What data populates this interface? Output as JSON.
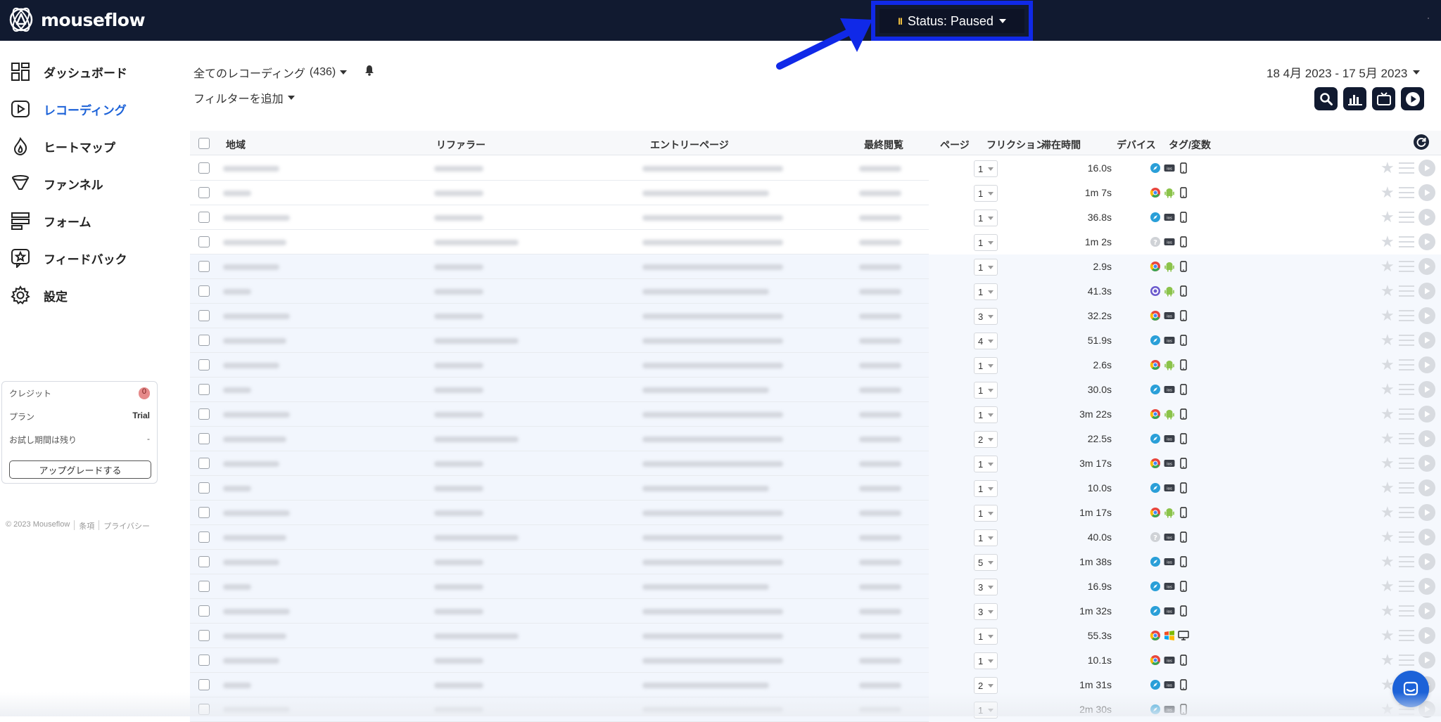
{
  "app": {
    "logo_text": "mouseflow"
  },
  "status": {
    "label": "Status: Paused",
    "pause_glyph": "II"
  },
  "sidebar": {
    "items": [
      {
        "label": "ダッシュボード",
        "icon": "dashboard-icon"
      },
      {
        "label": "レコーディング",
        "icon": "play-square-icon"
      },
      {
        "label": "ヒートマップ",
        "icon": "flame-icon"
      },
      {
        "label": "ファンネル",
        "icon": "funnel-icon"
      },
      {
        "label": "フォーム",
        "icon": "form-icon"
      },
      {
        "label": "フィードバック",
        "icon": "feedback-star-icon"
      },
      {
        "label": "設定",
        "icon": "gear-icon"
      }
    ],
    "credit": {
      "credit_label": "クレジット",
      "credit_value": "0",
      "plan_label": "プラン",
      "plan_value": "Trial",
      "trial_label": "お試し期間は残り",
      "trial_value": "-",
      "upgrade_label": "アップグレードする"
    },
    "footer": {
      "copyright": "© 2023 Mouseflow",
      "terms": "条項",
      "privacy": "プライバシー"
    }
  },
  "main": {
    "recordings_label": "全てのレコーディング",
    "recordings_count": "(436)",
    "add_filter_label": "フィルターを追加",
    "date_range": "18 4月 2023 - 17 5月 2023",
    "toolbar_icons": [
      "search-icon",
      "bar-chart-icon",
      "tv-icon",
      "play-circle-icon"
    ]
  },
  "table": {
    "columns": {
      "region": "地域",
      "referrer": "リファラー",
      "entry_page": "エントリーページ",
      "last_view": "最終閲覧",
      "pages": "ページ",
      "friction": "フリクション",
      "duration": "滞在時間",
      "device": "デバイス",
      "tags": "タグ/変数"
    },
    "rows": [
      {
        "pages": "1",
        "duration": "16.0s",
        "browser": "safari",
        "os": "mac",
        "device": "mobile"
      },
      {
        "pages": "1",
        "duration": "1m 7s",
        "browser": "chrome",
        "os": "android",
        "device": "mobile"
      },
      {
        "pages": "1",
        "duration": "36.8s",
        "browser": "safari",
        "os": "mac",
        "device": "mobile"
      },
      {
        "pages": "1",
        "duration": "1m 2s",
        "browser": "unknown",
        "os": "mac",
        "device": "mobile"
      },
      {
        "pages": "1",
        "duration": "2.9s",
        "browser": "chrome",
        "os": "android",
        "device": "mobile"
      },
      {
        "pages": "1",
        "duration": "41.3s",
        "browser": "other",
        "os": "android",
        "device": "mobile"
      },
      {
        "pages": "3",
        "duration": "32.2s",
        "browser": "chrome",
        "os": "mac",
        "device": "mobile"
      },
      {
        "pages": "4",
        "duration": "51.9s",
        "browser": "safari",
        "os": "mac",
        "device": "mobile"
      },
      {
        "pages": "1",
        "duration": "2.6s",
        "browser": "chrome",
        "os": "android",
        "device": "mobile"
      },
      {
        "pages": "1",
        "duration": "30.0s",
        "browser": "safari",
        "os": "mac",
        "device": "mobile"
      },
      {
        "pages": "1",
        "duration": "3m 22s",
        "browser": "chrome",
        "os": "android",
        "device": "mobile"
      },
      {
        "pages": "2",
        "duration": "22.5s",
        "browser": "safari",
        "os": "mac",
        "device": "mobile"
      },
      {
        "pages": "1",
        "duration": "3m 17s",
        "browser": "chrome",
        "os": "mac",
        "device": "mobile"
      },
      {
        "pages": "1",
        "duration": "10.0s",
        "browser": "safari",
        "os": "mac",
        "device": "mobile"
      },
      {
        "pages": "1",
        "duration": "1m 17s",
        "browser": "chrome",
        "os": "android",
        "device": "mobile"
      },
      {
        "pages": "1",
        "duration": "40.0s",
        "browser": "unknown",
        "os": "mac",
        "device": "mobile"
      },
      {
        "pages": "5",
        "duration": "1m 38s",
        "browser": "safari",
        "os": "mac",
        "device": "mobile"
      },
      {
        "pages": "3",
        "duration": "16.9s",
        "browser": "safari",
        "os": "mac",
        "device": "mobile"
      },
      {
        "pages": "3",
        "duration": "1m 32s",
        "browser": "safari",
        "os": "mac",
        "device": "mobile"
      },
      {
        "pages": "1",
        "duration": "55.3s",
        "browser": "chrome",
        "os": "windows",
        "device": "desktop"
      },
      {
        "pages": "1",
        "duration": "10.1s",
        "browser": "chrome",
        "os": "mac",
        "device": "mobile"
      },
      {
        "pages": "2",
        "duration": "1m 31s",
        "browser": "safari",
        "os": "mac",
        "device": "mobile"
      },
      {
        "pages": "1",
        "duration": "2m 30s",
        "browser": "safari",
        "os": "mac",
        "device": "mobile"
      }
    ]
  },
  "colors": {
    "topbar": "#111a30",
    "accent": "#1c62d8",
    "annotation": "#1029e8"
  }
}
